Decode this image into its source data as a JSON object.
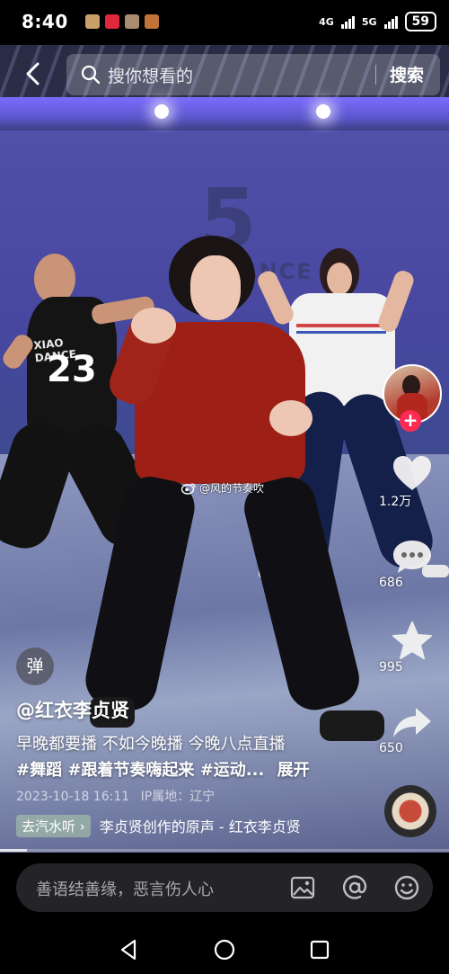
{
  "status_bar": {
    "time": "8:40",
    "network_1": "4G",
    "network_2": "5G",
    "battery": "59"
  },
  "search": {
    "placeholder": "搜你想看的",
    "button_label": "搜索"
  },
  "video": {
    "wall_logo_number": "5",
    "wall_logo_text": "DANCE",
    "shirt_number": "23",
    "shirt_text": "XIAO DANCE",
    "watermark": "@风的节奏吹"
  },
  "side_actions": {
    "likes": "1.2万",
    "comments": "686",
    "favorites": "995",
    "shares": "650",
    "follow_symbol": "+"
  },
  "post": {
    "danmu_label": "弹",
    "author": "@红衣李贞贤",
    "description_line1": "早晚都要播 不如今晚播 今晚八点直播",
    "description_line2": "#舞蹈 #跟着节奏嗨起来 #运动...",
    "expand_label": "展开",
    "date": "2023-10-18 16:11",
    "ip_location": "IP属地：辽宁",
    "music_tag": "去汽水听 ›",
    "music_title": "李贞贤创作的原声 - 红衣李贞贤"
  },
  "progress": 0.06,
  "comment_bar": {
    "placeholder": "善语结善缘，恶言伤人心"
  },
  "colors": {
    "accent": "#fe2c55",
    "comment_bar_bg": "#242428"
  },
  "icons": [
    "back-icon",
    "search-icon",
    "heart-icon",
    "comment-icon",
    "star-icon",
    "share-icon",
    "image-icon",
    "at-icon",
    "emoji-icon",
    "nav-back-icon",
    "nav-home-icon",
    "nav-recents-icon"
  ]
}
